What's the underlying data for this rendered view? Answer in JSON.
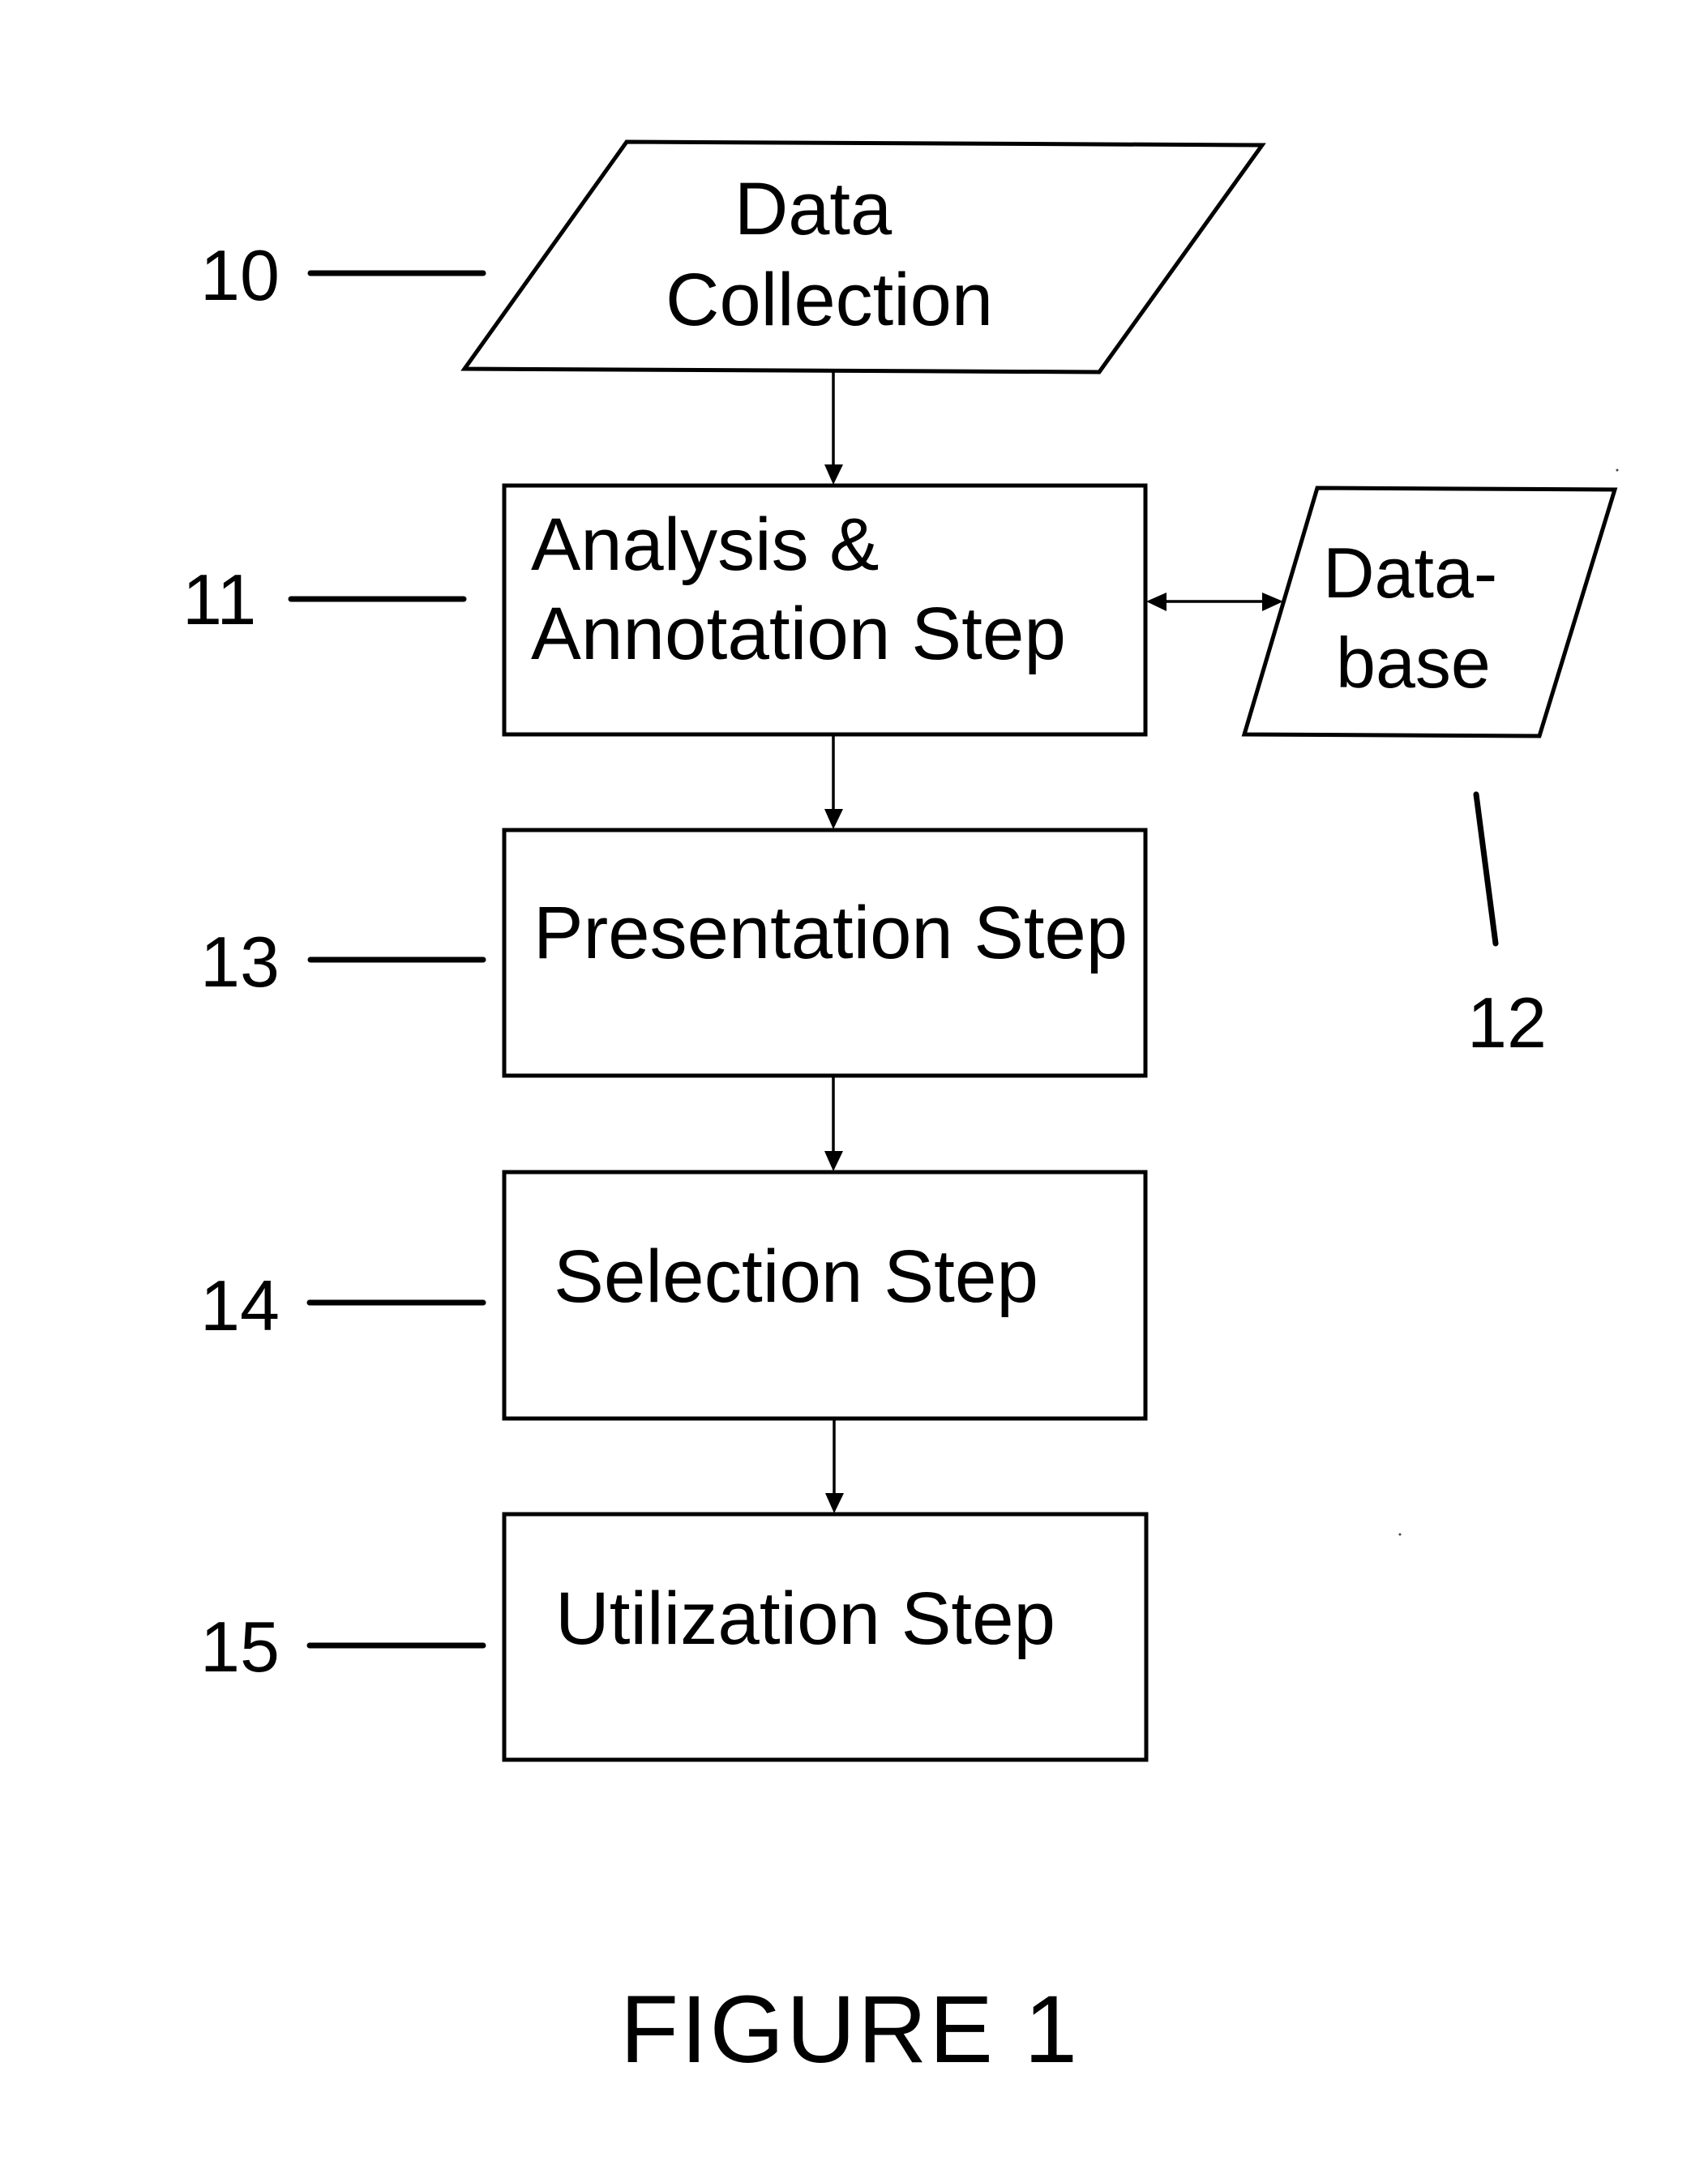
{
  "figure": {
    "caption": "FIGURE 1"
  },
  "nodes": {
    "data_collection": {
      "ref": "10",
      "shape": "parallelogram",
      "lines": [
        "Data",
        "Collection"
      ]
    },
    "analysis": {
      "ref": "11",
      "shape": "rectangle",
      "lines": [
        "Analysis &",
        "Annotation Step"
      ]
    },
    "database": {
      "ref": "12",
      "shape": "parallelogram",
      "lines": [
        "Data-",
        "base"
      ]
    },
    "presentation": {
      "ref": "13",
      "shape": "rectangle",
      "lines": [
        "Presentation Step"
      ]
    },
    "selection": {
      "ref": "14",
      "shape": "rectangle",
      "lines": [
        "Selection Step"
      ]
    },
    "utilization": {
      "ref": "15",
      "shape": "rectangle",
      "lines": [
        "Utilization Step"
      ]
    }
  },
  "edges": [
    {
      "from": "data_collection",
      "to": "analysis",
      "direction": "forward"
    },
    {
      "from": "analysis",
      "to": "database",
      "direction": "bidirectional"
    },
    {
      "from": "analysis",
      "to": "presentation",
      "direction": "forward"
    },
    {
      "from": "presentation",
      "to": "selection",
      "direction": "forward"
    },
    {
      "from": "selection",
      "to": "utilization",
      "direction": "forward"
    }
  ],
  "colors": {
    "ink": "#000000",
    "paper": "#ffffff"
  }
}
